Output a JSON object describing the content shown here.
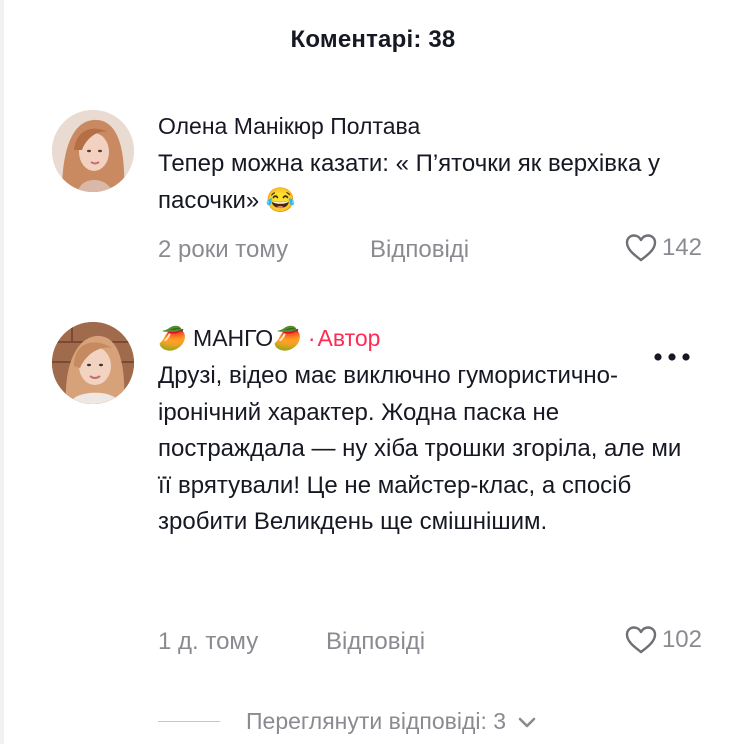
{
  "header": {
    "title": "Коментарі: 38"
  },
  "comments": [
    {
      "author": "Олена Манікюр Полтава",
      "text": "Тепер можна казати: « П’яточки як верхівка у пасочки» 😂",
      "time": "2 роки тому",
      "reply_label": "Відповіді",
      "likes": "142"
    },
    {
      "author_prefix": "🥭",
      "author": "МАНГО🥭",
      "author_badge_sep": "·",
      "author_badge": "Автор",
      "text": "Друзі, відео має виключно гумористично-іронічний характер. Жодна паска не постраждала — ну хіба трошки згоріла, але ми її врятували! Це не майстер-клас, а спосіб зробити Великдень ще смішнішим.",
      "time": "1 д. тому",
      "reply_label": "Відповіді",
      "likes": "102"
    }
  ],
  "view_replies": {
    "label": "Переглянути відповіді: 3"
  },
  "colors": {
    "accent": "#fe2c55",
    "muted": "#8a8b91",
    "text": "#161823"
  },
  "icons": [
    "heart-outline-icon",
    "more-dots-icon",
    "chevron-down-icon"
  ]
}
